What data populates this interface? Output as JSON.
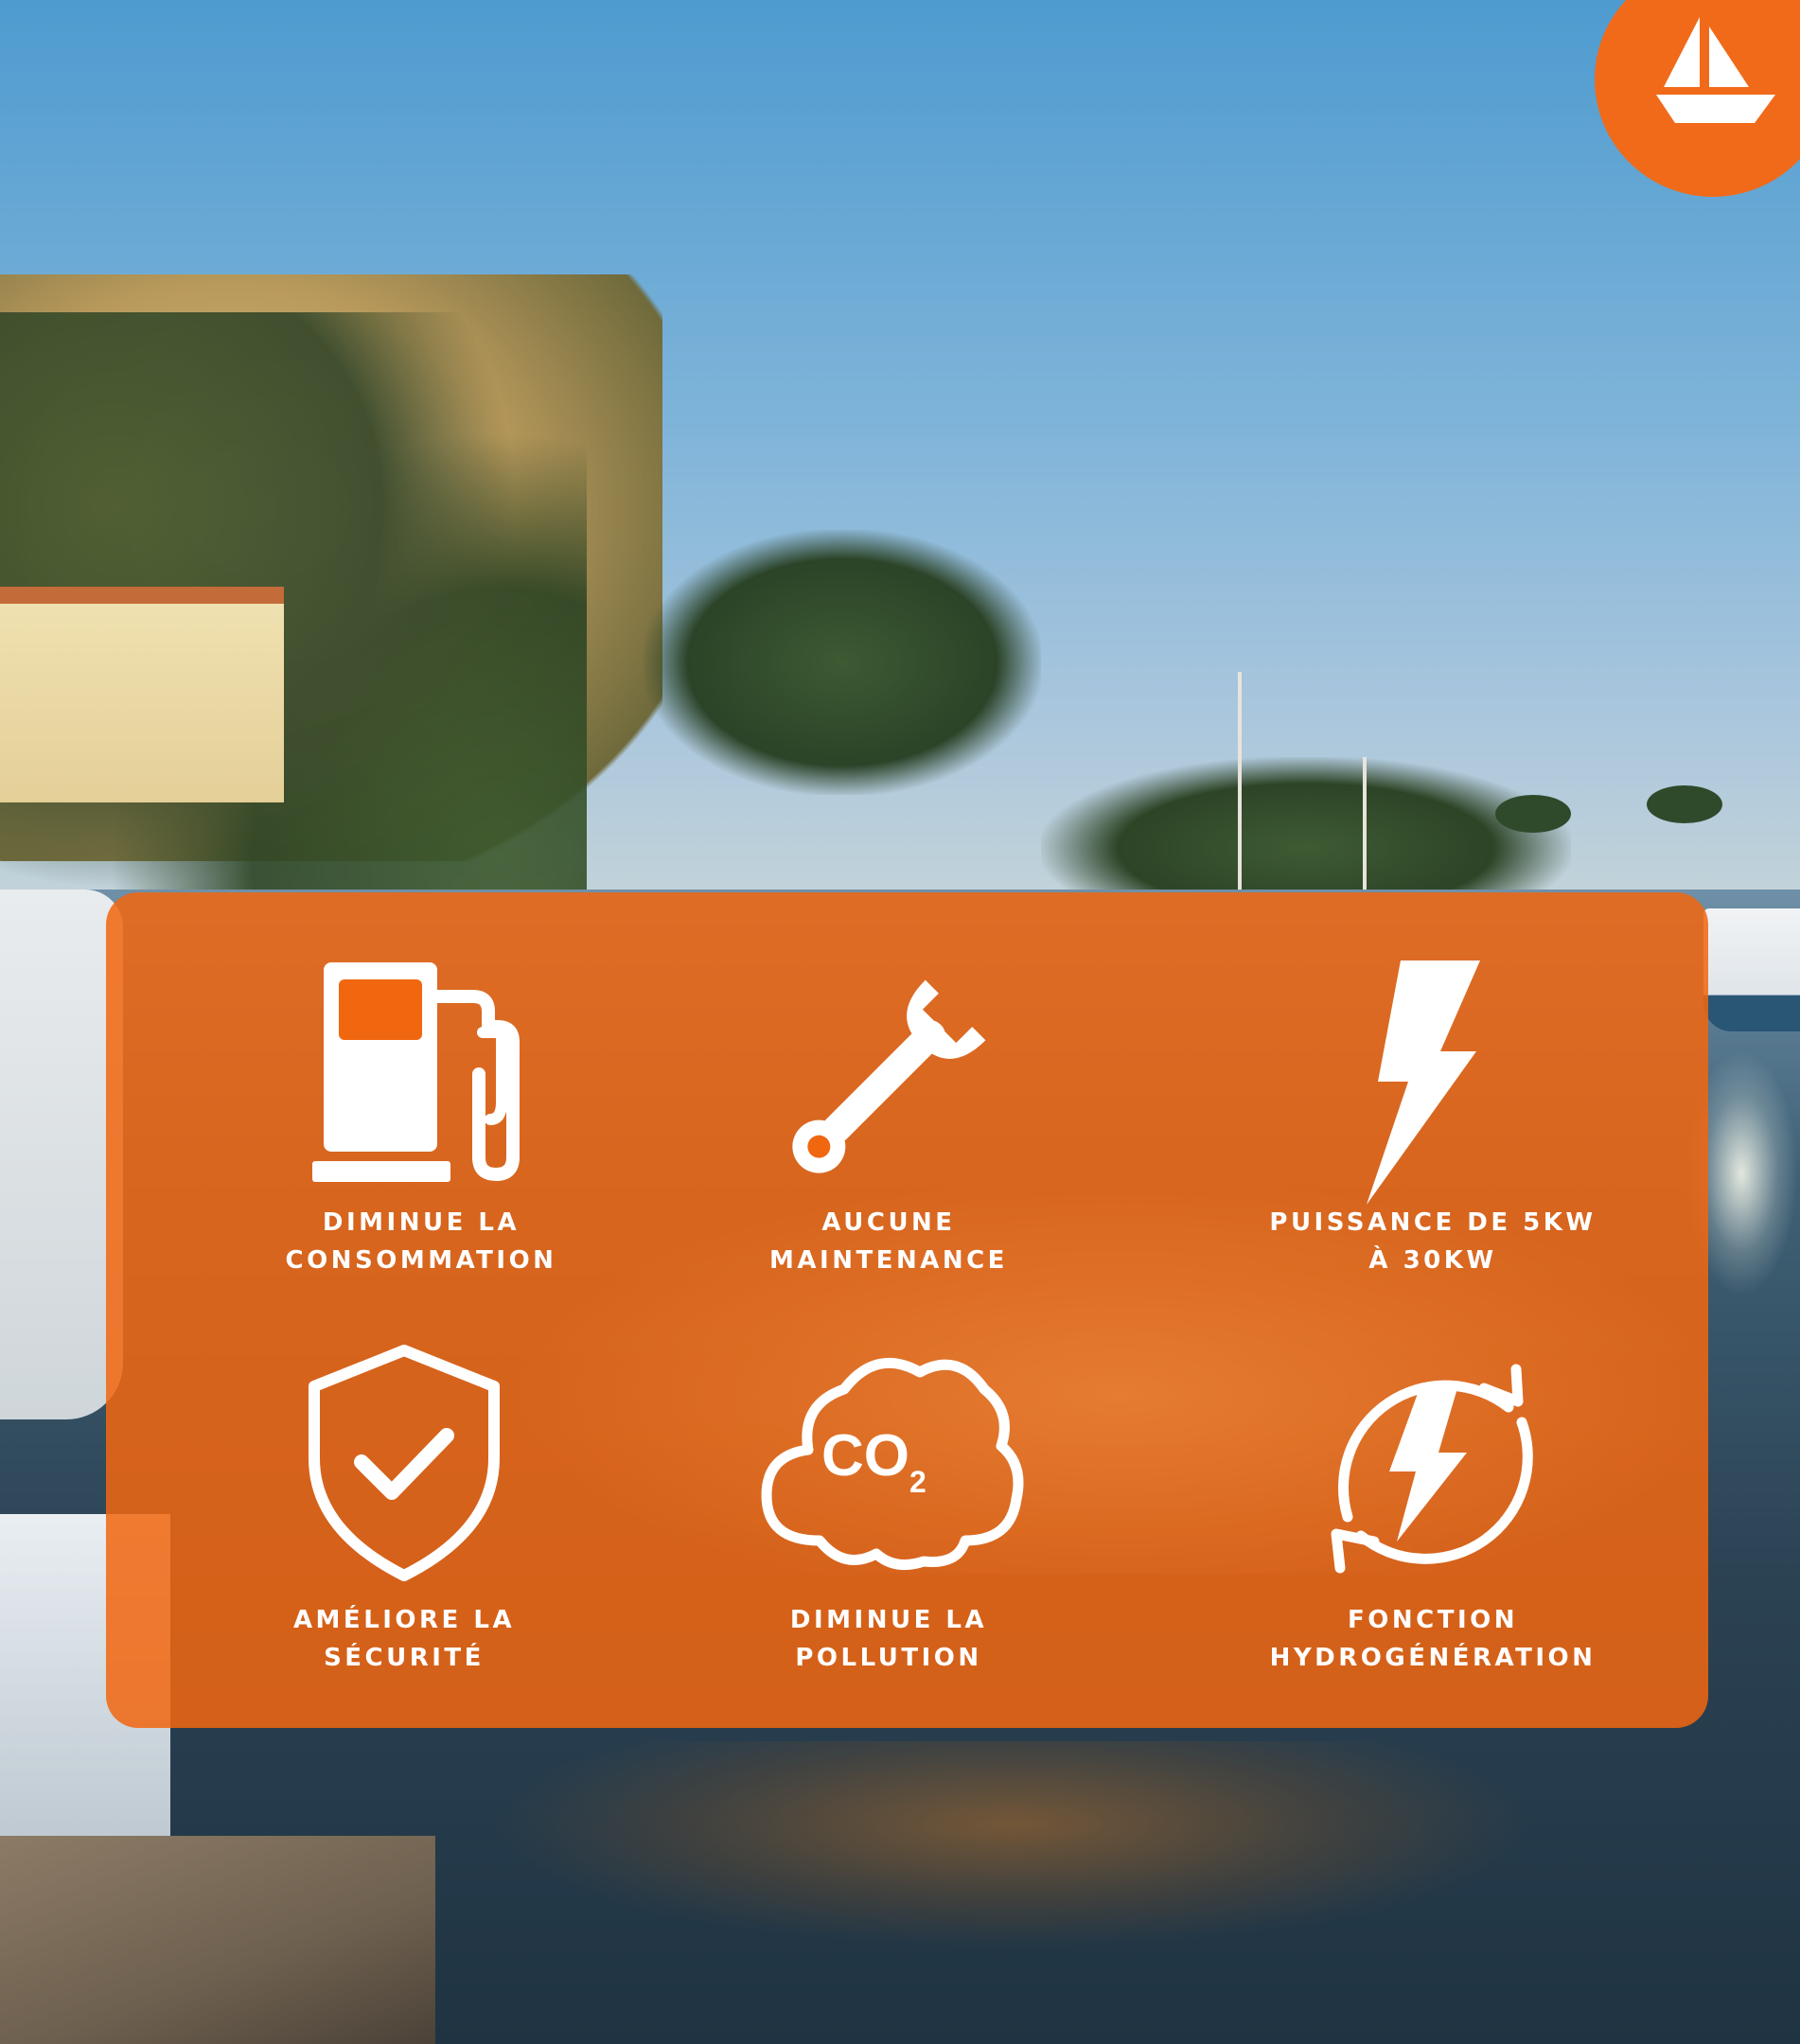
{
  "brand": {
    "accent_color": "#f06a1a",
    "logo_icon": "sailboat-icon"
  },
  "background": {
    "description_colors": {
      "sky": "#4e9bd0",
      "water": "#2b4253"
    }
  },
  "features": [
    {
      "icon": "fuel-pump-icon",
      "line1": "DIMINUE LA",
      "line2": "CONSOMMATION"
    },
    {
      "icon": "wrench-icon",
      "line1": "AUCUNE",
      "line2": "MAINTENANCE"
    },
    {
      "icon": "lightning-bolt-icon",
      "line1": "PUISSANCE DE 5KW",
      "line2": "À 30KW"
    },
    {
      "icon": "shield-check-icon",
      "line1": "AMÉLIORE LA",
      "line2": "SÉCURITÉ"
    },
    {
      "icon": "co2-cloud-icon",
      "line1": "DIMINUE LA",
      "line2": "POLLUTION",
      "icon_text": "CO",
      "icon_sub": "2"
    },
    {
      "icon": "hydrogeneration-cycle-icon",
      "line1": "FONCTION",
      "line2": "HYDROGÉNÉRATION"
    }
  ]
}
